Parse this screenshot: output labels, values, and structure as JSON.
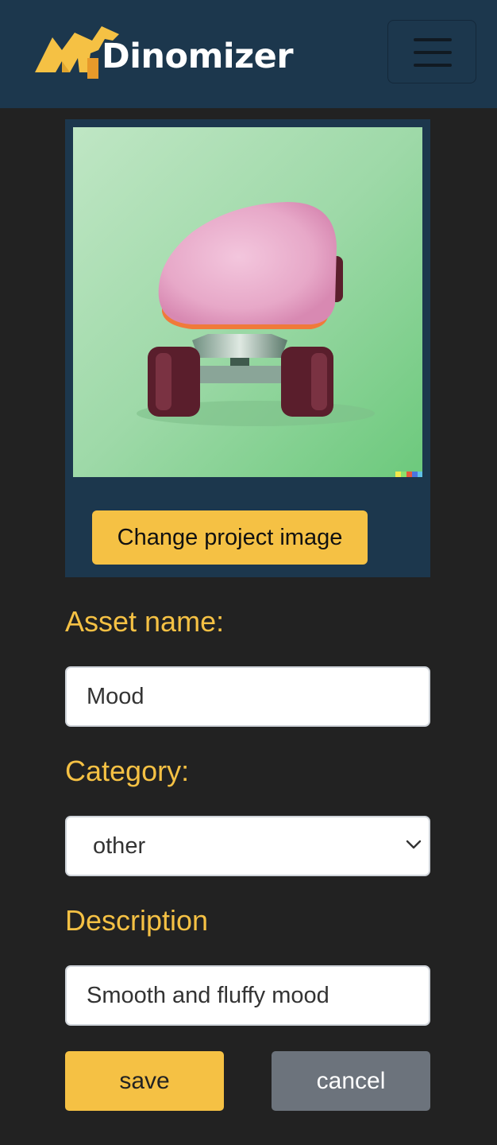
{
  "header": {
    "brand_name": "Dinomizer",
    "menu_icon": "hamburger-menu-icon",
    "background": "#1c374d"
  },
  "image_card": {
    "image_description_icon": "skateboard-image",
    "change_image_label": "Change project image"
  },
  "form": {
    "asset_name_label": "Asset name:",
    "asset_name_value": "Mood",
    "category_label": "Category:",
    "category_value": "other",
    "description_label": "Description",
    "description_value": "Smooth and fluffy mood"
  },
  "actions": {
    "save_label": "save",
    "cancel_label": "cancel"
  },
  "colors": {
    "accent": "#f5c144",
    "page_background": "#222222",
    "secondary_button": "#6c737c"
  }
}
